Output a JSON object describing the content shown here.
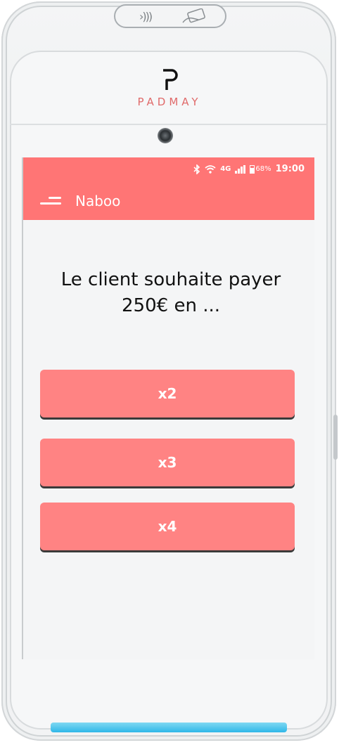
{
  "device": {
    "brand_name": "PADMAY",
    "nfc_symbol": "›)))"
  },
  "status_bar": {
    "network": "4G",
    "battery": "68%",
    "time": "19:00",
    "icons": [
      "bluetooth-icon",
      "wifi-icon",
      "signal-icon",
      "battery-icon"
    ]
  },
  "app_bar": {
    "title": "Naboo",
    "menu_icon": "hamburger-menu-icon"
  },
  "main": {
    "question_line1": "Le client souhaite payer",
    "question_line2": "250€ en ...",
    "options": [
      {
        "label": "x2"
      },
      {
        "label": "x3"
      },
      {
        "label": "x4"
      }
    ]
  },
  "colors": {
    "accent": "#ff7575",
    "button": "#ff8383",
    "screen_bg": "#f4f5f6",
    "text": "#111111",
    "nfc_led": "#2fb7e8"
  }
}
